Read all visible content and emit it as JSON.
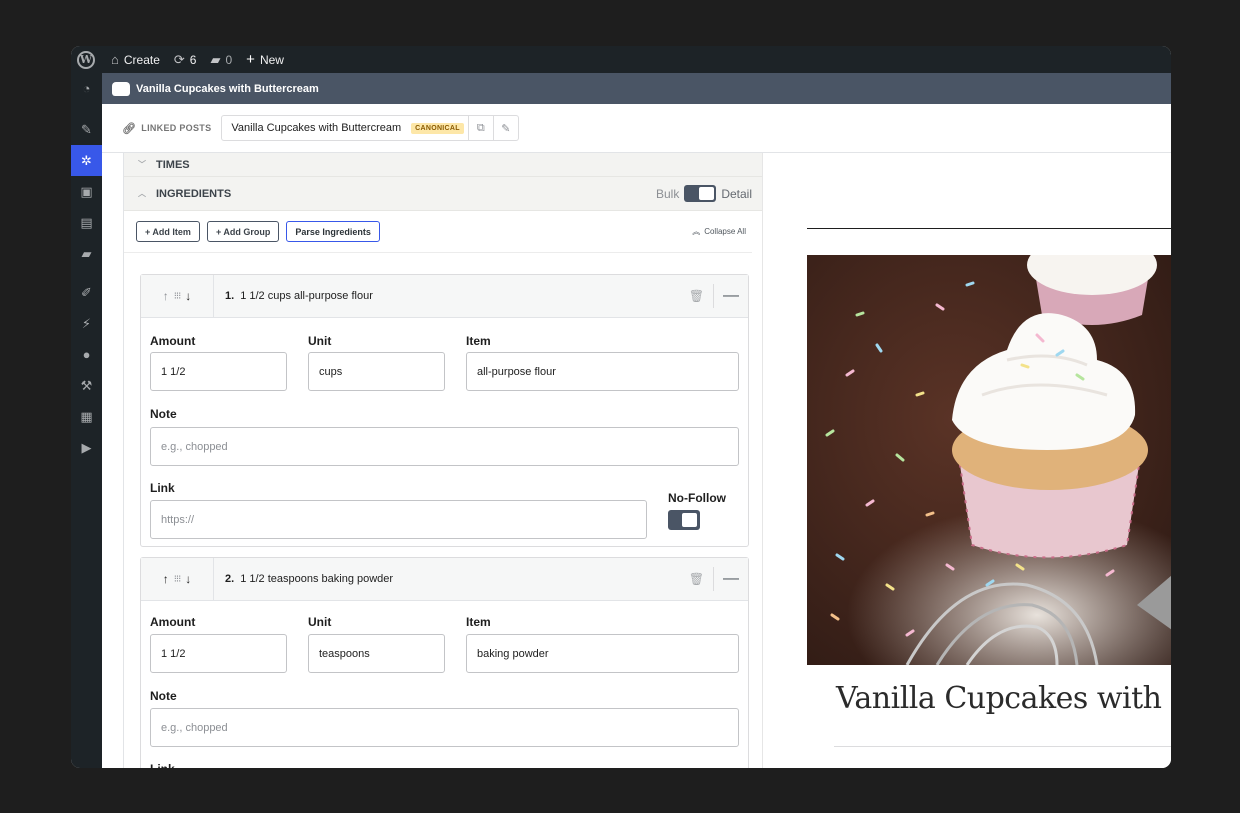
{
  "admin_bar": {
    "site_label": "Create",
    "updates_count": "6",
    "comments_count": "0",
    "new_label": "New"
  },
  "plugin_header": {
    "title": "Vanilla Cupcakes with Buttercream"
  },
  "linked_posts": {
    "label": "LINKED POSTS",
    "post_title": "Vanilla Cupcakes with Buttercream",
    "badge": "CANONICAL"
  },
  "sections": {
    "times_label": "TIMES",
    "ingredients_label": "INGREDIENTS",
    "bulk_label": "Bulk",
    "detail_label": "Detail"
  },
  "toolbar": {
    "add_item": "+ Add Item",
    "add_group": "+ Add Group",
    "parse": "Parse Ingredients",
    "collapse_all": "Collapse All"
  },
  "field_labels": {
    "amount": "Amount",
    "unit": "Unit",
    "item": "Item",
    "note": "Note",
    "link": "Link",
    "no_follow": "No-Follow"
  },
  "ingredients": [
    {
      "number": "1.",
      "summary": "1 1/2 cups all-purpose flour",
      "amount": "1 1/2",
      "unit": "cups",
      "item": "all-purpose flour",
      "note_placeholder": "e.g., chopped",
      "link_placeholder": "https://",
      "no_follow": true
    },
    {
      "number": "2.",
      "summary": "1 1/2 teaspoons baking powder",
      "amount": "1 1/2",
      "unit": "teaspoons",
      "item": "baking powder",
      "note_placeholder": "e.g., chopped"
    }
  ],
  "preview": {
    "recipe_title": "Vanilla Cupcakes with"
  },
  "colors": {
    "accent": "#3858e9",
    "header": "#4a5565",
    "admin_bar": "#1d2327"
  }
}
